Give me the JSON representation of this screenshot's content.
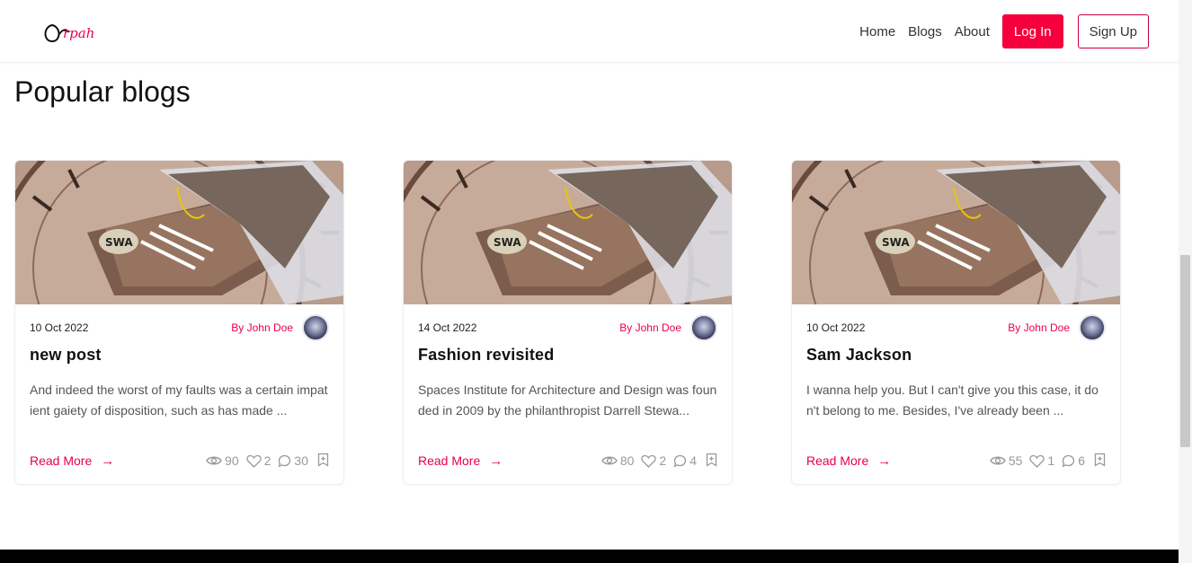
{
  "brand": {
    "logo_text": "Orpah"
  },
  "nav": {
    "links": [
      "Home",
      "Blogs",
      "About"
    ],
    "login_label": "Log In",
    "signup_label": "Sign Up"
  },
  "section": {
    "title": "Popular blogs"
  },
  "cards": [
    {
      "date": "10 Oct 2022",
      "author": "By John Doe",
      "title": "new post",
      "excerpt": "And indeed the worst of my faults was a certain impatient gaiety of disposition, such as has made ...",
      "read_more": "Read More",
      "views": "90",
      "likes": "2",
      "comments": "30"
    },
    {
      "date": "14 Oct 2022",
      "author": "By John Doe",
      "title": "Fashion revisited",
      "excerpt": "Spaces Institute for Architecture and Design was founded in 2009 by the philanthropist Darrell Stewa...",
      "read_more": "Read More",
      "views": "80",
      "likes": "2",
      "comments": "4"
    },
    {
      "date": "10 Oct 2022",
      "author": "By John Doe",
      "title": "Sam Jackson",
      "excerpt": "I wanna help you. But I can't give you this case, it don't belong to me. Besides, I've already been ...",
      "read_more": "Read More",
      "views": "55",
      "likes": "1",
      "comments": "6"
    }
  ],
  "colors": {
    "accent": "#f5003d",
    "author": "#e8004a"
  }
}
